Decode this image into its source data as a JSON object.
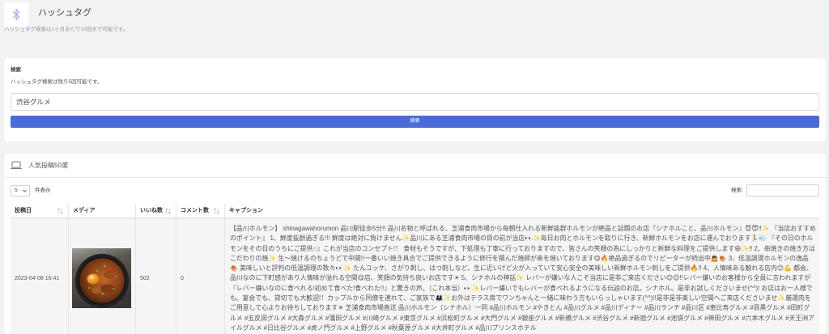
{
  "header": {
    "icon": "bluetooth-icon",
    "title": "ハッシュタグ",
    "subtitle": "ハッシュタグ検索は1ヶ月あたり10回まで可能です。"
  },
  "search": {
    "heading": "検索",
    "remaining_text": "ハッシュタグ検索は残り5回可能です。",
    "input_value": "渋谷グルメ",
    "button_label": "検索"
  },
  "results": {
    "icon": "laptop-icon",
    "title": "人気投稿50選",
    "page_length": {
      "selected": "5",
      "label": "件表示",
      "icon": "chevron-down-icon"
    },
    "filter": {
      "label": "検索:"
    },
    "sort_icon": "sort-icon",
    "columns": [
      {
        "label": "投稿日",
        "sortable": true
      },
      {
        "label": "メディア",
        "sortable": false
      },
      {
        "label": "いいね数",
        "sortable": true
      },
      {
        "label": "コメント数",
        "sortable": true
      },
      {
        "label": "キャプション",
        "sortable": false
      }
    ],
    "rows": [
      {
        "date": "2023-04-08 16:41",
        "likes": "502",
        "comments": "0",
        "caption": "【品川ホルモン】 shinagawahorumon 品川駅徒歩5分!! 品川名物と呼ばれる、芝浦食肉市場から毎朝仕入れる新鮮抜群ホルモンが絶品と話題のお店『シナホルこと、品川ホルモン』😈😈‼✨ 『当店おすすめのポイント』 1、鮮度抜群過ぎる!!! 鮮度は絶対に負けません✨品川にある芝浦食肉市場の目の前が当店👀✨毎日お肉とホルモンを取りに行き、新鮮ホルモンをお店に運んでおります🏃💨 『その日のホルモンをその日のうちにご提供☝』これが当店のコンセプト!！ 食材もそうですが、下処理も丁寧に行っておりますので、皆さんの笑顔の為にしっかりと新鮮な料理をご提供します😆✨‼ 2、串焼きの焼き方はこだわりの焼✨ 生〜焼けるのちょうどで中間!!一番いい焼き具合でご提供できるように修行を積んだ焼師が串を焼いております😋🔥絶品過ぎるのでリピーターが続出中🙇🍖 3、低温調理ホルモンの逸品🍖 美味しいと評判の低温調理の数々👀✨ たんユッケ、さがり刺し、はつ刺しなど、生に近いけど火が入っていて安心安全の美味しい新鮮ホルモン刺しをご提供🔥‼ 4、人情味ある触れる店内😊💪 都会、品川なのに下町感があり人情味が溢れる空間😋店、笑顔の気持ち良いお店です☀ 5、シナホルの神話✨ レバーが嫌いな人こそ当店に是非ご来店ください😊😊!!レバー嫌いのお客様から全員に言われますが『レバー嫌いなのに食べれる!初めて食べた!食べれた!!』と驚きの声。（これ本当）👀✨レバー嫌いでもレバーが食べれるようになる伝説のお店。シナホル。是非お試しくださいませ(^^)! お店はお一人様でも、宴会でも、貸切でも大歓迎!！カップルから同僚を連れて、ご家族で👨‍👩‍👧✨お外はテラス席でワンちゃんと一緒に味わう方もいらっしゃいます(^^)!!是非是非楽しい空間へご来店くださいませ✨厳選肉をご用意して心よりお待ちしております☀ 芝浦食肉市場直送 品川ホルモン（シナホル）一同 #品川ホルモン #やきとん #品川グルメ #品川ディナー #品川ランチ #品川区 #恵比寿グルメ #目黒グルメ #田町グルメ #五反田グルメ #大森グルメ #蒲田グルメ #川崎グルメ #東京グルメ #浜松町グルメ #大門グルメ #銀座グルメ #新橋グルメ #渋谷グルメ #新宿グルメ #池袋グルメ #神田グルメ #六本木グルメ #天王洲アイルグルメ #日比谷グルメ #虎ノ門グルメ #上野グルメ #秋葉原グルメ #大井町グルメ #品川プリンスホテル"
      }
    ]
  },
  "colors": {
    "page_background": "#f1f2f4",
    "card_background": "#ffffff",
    "accent": "#4a6cd9",
    "icon": "#a5b5ec",
    "row_background": "#f5f5f5"
  }
}
